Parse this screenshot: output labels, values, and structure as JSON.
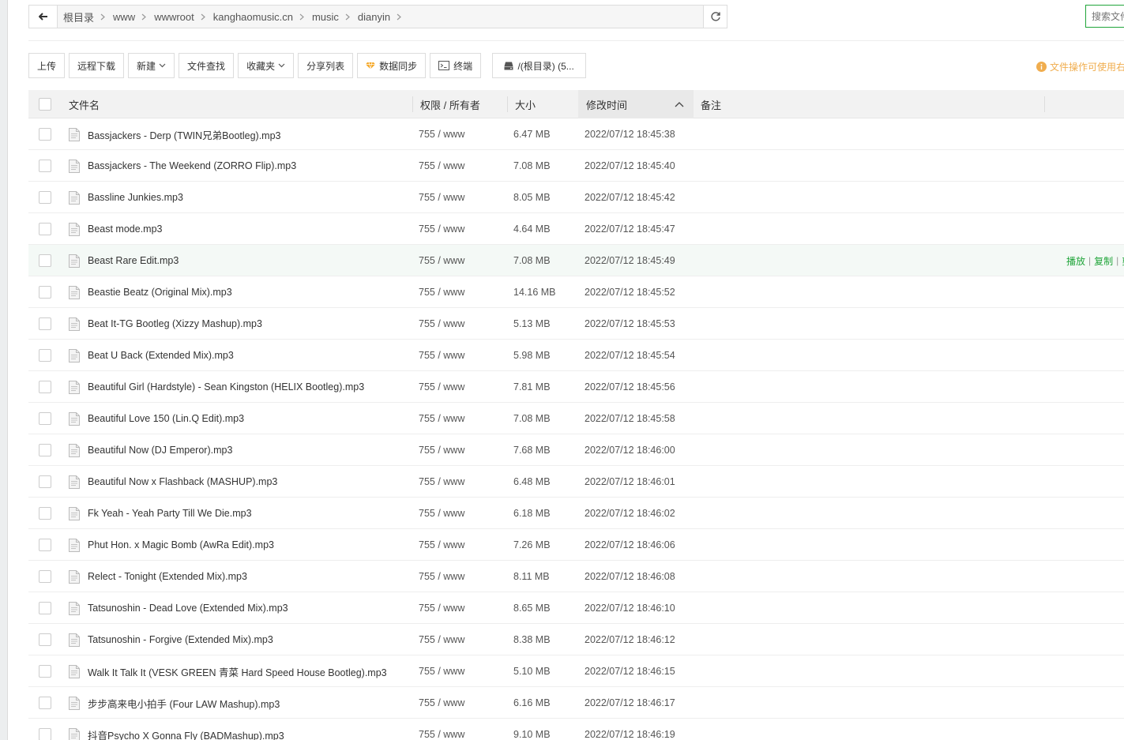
{
  "path": {
    "crumbs": [
      "根目录",
      "www",
      "wwwroot",
      "kanghaomusic.cn",
      "music",
      "dianyin"
    ]
  },
  "search": {
    "placeholder": "搜索文件"
  },
  "toolbar": {
    "upload": "上传",
    "remote_download": "远程下载",
    "new": "新建",
    "file_search": "文件查找",
    "favorites": "收藏夹",
    "share_list": "分享列表",
    "data_sync": "数据同步",
    "terminal": "终端",
    "disk": "/(根目录) (5..."
  },
  "tip": {
    "text": "文件操作可使用右"
  },
  "table": {
    "headers": {
      "name": "文件名",
      "perm": "权限 / 所有者",
      "size": "大小",
      "mtime": "修改时间",
      "note": "备注"
    },
    "sort_column": "mtime",
    "hover_row_index": 4,
    "hover_ops": [
      "播放",
      "复制",
      "剪"
    ],
    "rows": [
      {
        "name": "Bassjackers - Derp (TWIN兄弟Bootleg).mp3",
        "perm": "755 / www",
        "size": "6.47 MB",
        "mtime": "2022/07/12 18:45:38"
      },
      {
        "name": "Bassjackers - The Weekend (ZORRO Flip).mp3",
        "perm": "755 / www",
        "size": "7.08 MB",
        "mtime": "2022/07/12 18:45:40"
      },
      {
        "name": "Bassline Junkies.mp3",
        "perm": "755 / www",
        "size": "8.05 MB",
        "mtime": "2022/07/12 18:45:42"
      },
      {
        "name": "Beast mode.mp3",
        "perm": "755 / www",
        "size": "4.64 MB",
        "mtime": "2022/07/12 18:45:47"
      },
      {
        "name": "Beast Rare Edit.mp3",
        "perm": "755 / www",
        "size": "7.08 MB",
        "mtime": "2022/07/12 18:45:49"
      },
      {
        "name": "Beastie Beatz (Original Mix).mp3",
        "perm": "755 / www",
        "size": "14.16 MB",
        "mtime": "2022/07/12 18:45:52"
      },
      {
        "name": "Beat It-TG Bootleg (Xizzy Mashup).mp3",
        "perm": "755 / www",
        "size": "5.13 MB",
        "mtime": "2022/07/12 18:45:53"
      },
      {
        "name": "Beat U Back (Extended Mix).mp3",
        "perm": "755 / www",
        "size": "5.98 MB",
        "mtime": "2022/07/12 18:45:54"
      },
      {
        "name": "Beautiful Girl (Hardstyle) - Sean Kingston (HELIX Bootleg).mp3",
        "perm": "755 / www",
        "size": "7.81 MB",
        "mtime": "2022/07/12 18:45:56"
      },
      {
        "name": "Beautiful Love 150 (Lin.Q Edit).mp3",
        "perm": "755 / www",
        "size": "7.08 MB",
        "mtime": "2022/07/12 18:45:58"
      },
      {
        "name": "Beautiful Now (DJ Emperor).mp3",
        "perm": "755 / www",
        "size": "7.68 MB",
        "mtime": "2022/07/12 18:46:00"
      },
      {
        "name": "Beautiful Now x Flashback (MASHUP).mp3",
        "perm": "755 / www",
        "size": "6.48 MB",
        "mtime": "2022/07/12 18:46:01"
      },
      {
        "name": "Fk Yeah - Yeah Party Till We Die.mp3",
        "perm": "755 / www",
        "size": "6.18 MB",
        "mtime": "2022/07/12 18:46:02"
      },
      {
        "name": "Phut Hon. x Magic Bomb (AwRa Edit).mp3",
        "perm": "755 / www",
        "size": "7.26 MB",
        "mtime": "2022/07/12 18:46:06"
      },
      {
        "name": "Relect - Tonight (Extended Mix).mp3",
        "perm": "755 / www",
        "size": "8.11 MB",
        "mtime": "2022/07/12 18:46:08"
      },
      {
        "name": "Tatsunoshin - Dead Love (Extended Mix).mp3",
        "perm": "755 / www",
        "size": "8.65 MB",
        "mtime": "2022/07/12 18:46:10"
      },
      {
        "name": "Tatsunoshin - Forgive (Extended Mix).mp3",
        "perm": "755 / www",
        "size": "8.38 MB",
        "mtime": "2022/07/12 18:46:12"
      },
      {
        "name": "Walk It Talk It (VESK GREEN 青菜 Hard Speed House Bootleg).mp3",
        "perm": "755 / www",
        "size": "5.10 MB",
        "mtime": "2022/07/12 18:46:15"
      },
      {
        "name": "步步高来电小拍手 (Four LAW Mashup).mp3",
        "perm": "755 / www",
        "size": "6.16 MB",
        "mtime": "2022/07/12 18:46:17"
      },
      {
        "name": "抖音Psycho X Gonna Fly (BADMashup).mp3",
        "perm": "755 / www",
        "size": "9.10 MB",
        "mtime": "2022/07/12 18:46:19"
      }
    ]
  },
  "colors": {
    "accent": "#20a53a",
    "warning": "#f0ad4e",
    "header_bg": "#f2f2f2",
    "hover_row_bg": "#f4f9f6"
  }
}
